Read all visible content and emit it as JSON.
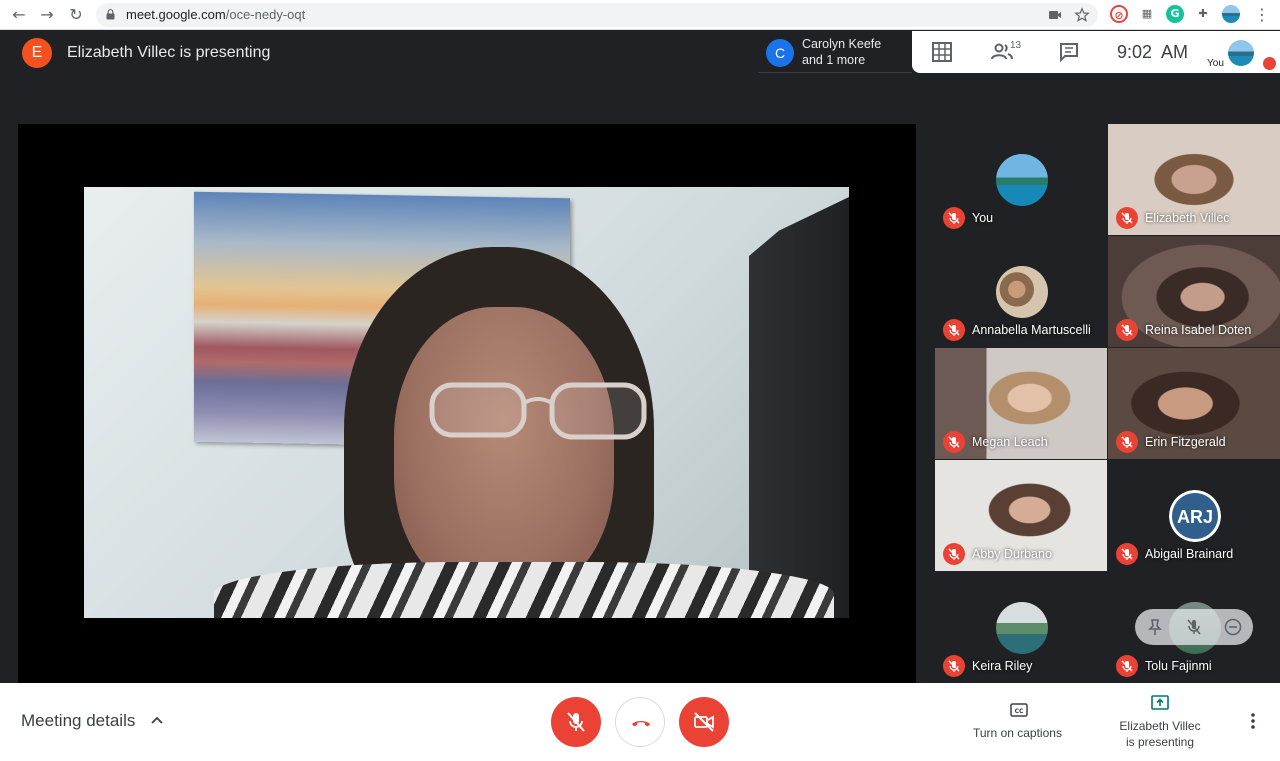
{
  "browser": {
    "url_host": "meet.google.com",
    "url_path": "/oce-nedy-oqt"
  },
  "meet": {
    "presenter_initial": "E",
    "presenter_text": "Elizabeth Villec is presenting",
    "notification": {
      "initial": "C",
      "line1": "Carolyn Keefe",
      "line2": "and 1 more"
    },
    "participant_count": "13",
    "time": "9:02  AM",
    "you_label": "You"
  },
  "participants": [
    {
      "name": "You"
    },
    {
      "name": "Elizabeth Villec"
    },
    {
      "name": "Annabella Martuscelli"
    },
    {
      "name": "Reina Isabel Doten"
    },
    {
      "name": "Megan Leach"
    },
    {
      "name": "Erin Fitzgerald"
    },
    {
      "name": "Abby Durbano"
    },
    {
      "name": "Abigail Brainard"
    },
    {
      "name": "Keira Riley"
    },
    {
      "name": "Tolu Fajinmi"
    }
  ],
  "bottom": {
    "meeting_details": "Meeting details",
    "captions": "Turn on captions",
    "presenting_line1": "Elizabeth Villec",
    "presenting_line2": "is presenting"
  },
  "icons": {
    "mic_off": "mic-off-icon",
    "end_call": "phone-hangup-icon",
    "cam_off": "camera-off-icon"
  },
  "colors": {
    "accent_red": "#ea4335",
    "presenter_orange": "#f4511e",
    "notif_blue": "#1a73e8",
    "present_green": "#00796b"
  }
}
